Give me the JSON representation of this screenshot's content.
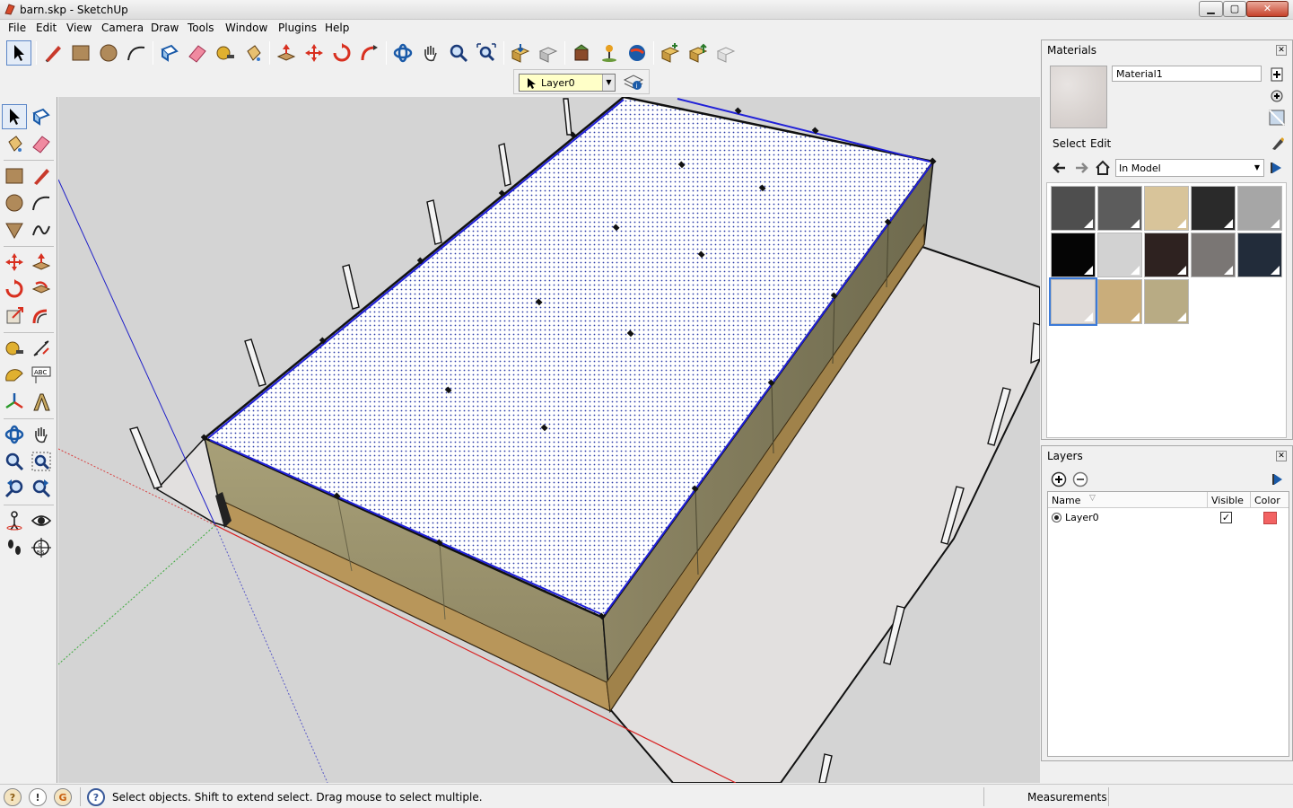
{
  "window": {
    "title": "barn.skp - SketchUp",
    "buttons": {
      "minimize": "▁",
      "maximize": "▢",
      "close": "✕"
    }
  },
  "menu": [
    "File",
    "Edit",
    "View",
    "Camera",
    "Draw",
    "Tools",
    "Window",
    "Plugins",
    "Help"
  ],
  "toolbar": {
    "icons": [
      "select-icon",
      "pencil-line-icon",
      "rectangle-icon",
      "circle-icon",
      "arc-icon",
      "make-component-icon",
      "eraser-icon",
      "tape-measure-icon",
      "paint-bucket-icon",
      "push-pull-icon",
      "move-icon",
      "rotate-icon",
      "follow-me-icon",
      "orbit-icon",
      "pan-icon",
      "zoom-icon",
      "zoom-extents-icon",
      "get-models-icon",
      "share-model-icon",
      "share-component-icon",
      "geo-location-icon",
      "google-earth-icon",
      "get-photo-texture-icon",
      "import-icon",
      "export-icon"
    ]
  },
  "layer_toolbar": {
    "current_layer": "Layer0"
  },
  "left_toolbar": {
    "icons": [
      "select-icon",
      "make-component-icon",
      "paint-bucket-icon",
      "eraser-icon",
      "rectangle-icon",
      "line-icon",
      "circle-icon",
      "arc-icon",
      "polygon-icon",
      "freehand-icon",
      "move-icon",
      "push-pull-icon",
      "rotate-icon",
      "follow-me-icon",
      "scale-icon",
      "offset-icon",
      "tape-measure-icon",
      "dimension-icon",
      "protractor-icon",
      "text-icon",
      "axes-icon",
      "3d-text-icon",
      "orbit-icon",
      "pan-icon",
      "zoom-icon",
      "zoom-window-icon",
      "previous-view-icon",
      "next-view-icon",
      "position-camera-icon",
      "look-around-icon",
      "walk-icon",
      "section-plane-icon"
    ]
  },
  "materials": {
    "title": "Materials",
    "material_name": "Material1",
    "tabs": [
      "Select",
      "Edit"
    ],
    "collection": "In Model",
    "swatches": [
      {
        "color": "#4e4e4e"
      },
      {
        "color": "#5c5c5c"
      },
      {
        "color": "#d8c49a"
      },
      {
        "color": "#2a2a2a"
      },
      {
        "color": "#a6a6a6"
      },
      {
        "color": "#050505"
      },
      {
        "color": "#d2d2d2"
      },
      {
        "color": "#2e2220"
      },
      {
        "color": "#7a7674"
      },
      {
        "color": "#222c3a"
      },
      {
        "color": "#e0dbd8"
      },
      {
        "color": "#c9ad7b"
      },
      {
        "color": "#b8ab84"
      }
    ]
  },
  "layers": {
    "title": "Layers",
    "columns": {
      "name": "Name",
      "visible": "Visible",
      "color": "Color"
    },
    "rows": [
      {
        "name": "Layer0",
        "visible": true,
        "color": "#f26262"
      }
    ]
  },
  "status": {
    "message": "Select objects. Shift to extend select. Drag mouse to select multiple.",
    "measurements_label": "Measurements",
    "icons": [
      "geo-location-status-icon",
      "credits-status-icon",
      "google-status-icon",
      "help-icon"
    ]
  }
}
